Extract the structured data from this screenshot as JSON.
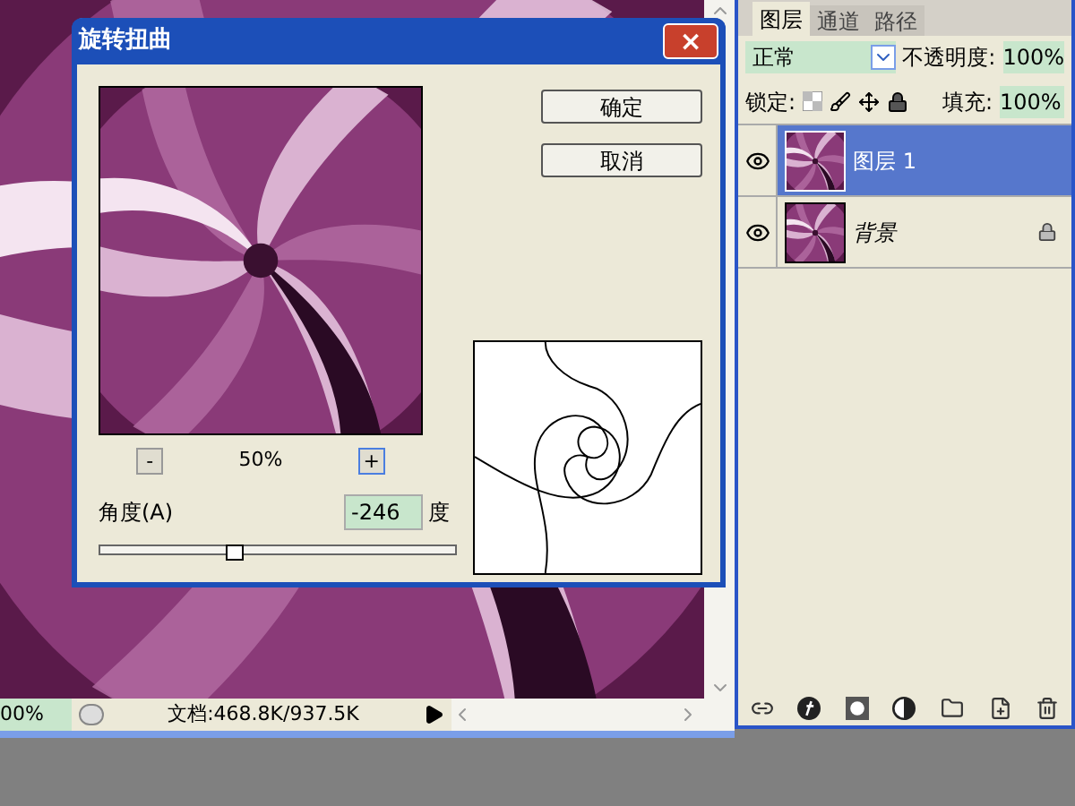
{
  "dialog": {
    "title": "旋转扭曲",
    "close": "×",
    "buttons": [
      "确定",
      "取消"
    ],
    "zoom_out": "-",
    "zoom_level": "50%",
    "zoom_in": "+",
    "angle_label": "角度(A)",
    "angle_value": "-246",
    "angle_unit": "度",
    "angle_slider": {
      "level": 0.38
    }
  },
  "layers_panel": {
    "tabs": [
      {
        "label": "图层",
        "selected": true
      },
      {
        "label": "通道",
        "selected": false
      },
      {
        "label": "路径",
        "selected": false
      }
    ],
    "blend_mode": "正常",
    "opacity_label": "不透明度:",
    "opacity": "100%",
    "lock_label": "锁定:",
    "fill_label": "填充:",
    "fill": "100%",
    "layers": [
      {
        "name": "图层 1",
        "selected": true,
        "locked": false,
        "kind": "layer"
      },
      {
        "name": "背景",
        "selected": false,
        "locked": true,
        "kind": "background"
      }
    ]
  },
  "status_bar": {
    "zoom": "00%",
    "document": "文档:468.8K/937.5K"
  }
}
